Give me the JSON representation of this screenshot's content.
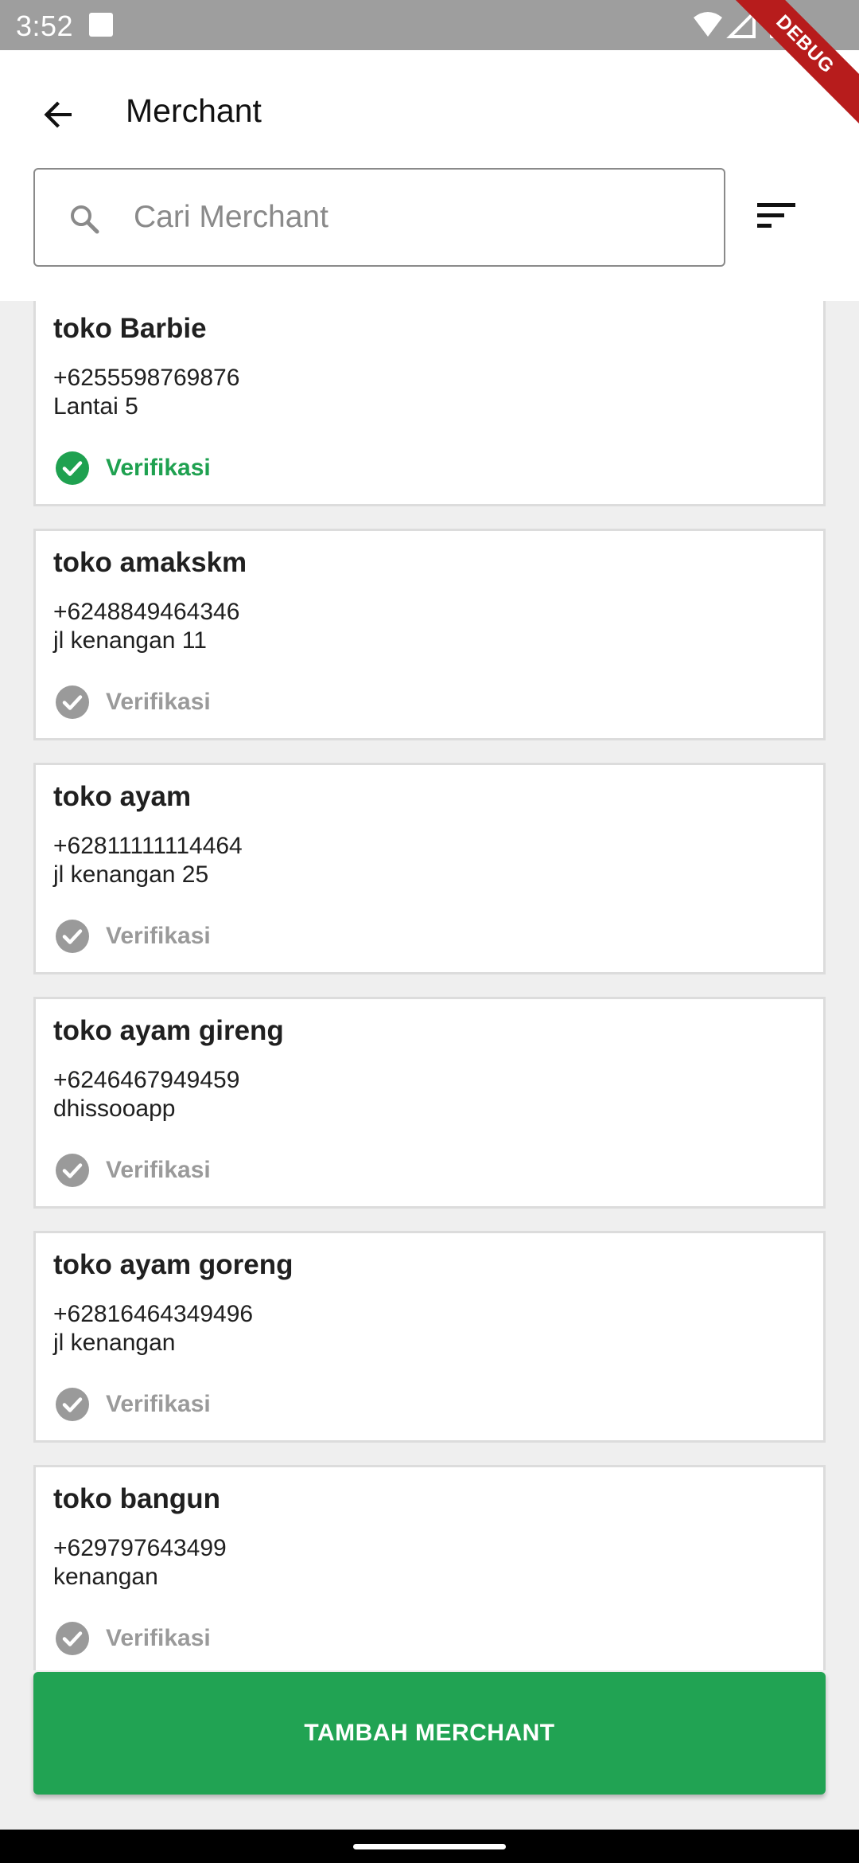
{
  "status_bar": {
    "time": "3:52",
    "icons": [
      "notification-square-icon",
      "wifi-icon",
      "signal-icon",
      "battery-icon"
    ],
    "debug_label": "DEBUG"
  },
  "header": {
    "back_icon": "arrow-left-icon",
    "title": "Merchant"
  },
  "search": {
    "placeholder": "Cari Merchant",
    "value": "",
    "icon": "search-icon"
  },
  "filter": {
    "icon": "sort-icon"
  },
  "merchants": [
    {
      "name": "toko Barbie",
      "phone": "+6255598769876",
      "address": "Lantai 5",
      "verify_label": "Verifikasi",
      "verified": true
    },
    {
      "name": "toko amakskm",
      "phone": "+6248849464346",
      "address": "jl kenangan 11",
      "verify_label": "Verifikasi",
      "verified": false
    },
    {
      "name": "toko ayam",
      "phone": "+62811111114464",
      "address": "jl kenangan 25",
      "verify_label": "Verifikasi",
      "verified": false
    },
    {
      "name": "toko ayam gireng",
      "phone": "+6246467949459",
      "address": "dhissooapp",
      "verify_label": "Verifikasi",
      "verified": false
    },
    {
      "name": "toko ayam goreng",
      "phone": "+62816464349496",
      "address": "jl kenangan",
      "verify_label": "Verifikasi",
      "verified": false
    },
    {
      "name": "toko bangun",
      "phone": "+629797643499",
      "address": "kenangan",
      "verify_label": "Verifikasi",
      "verified": false
    }
  ],
  "actions": {
    "add_merchant_label": "TAMBAH MERCHANT"
  },
  "colors": {
    "accent_green": "#21a353",
    "verified_green": "#1fa150",
    "unverified_gray": "#9a9a9a",
    "status_bar": "#9e9e9e",
    "debug_ribbon": "#b71c1c"
  }
}
